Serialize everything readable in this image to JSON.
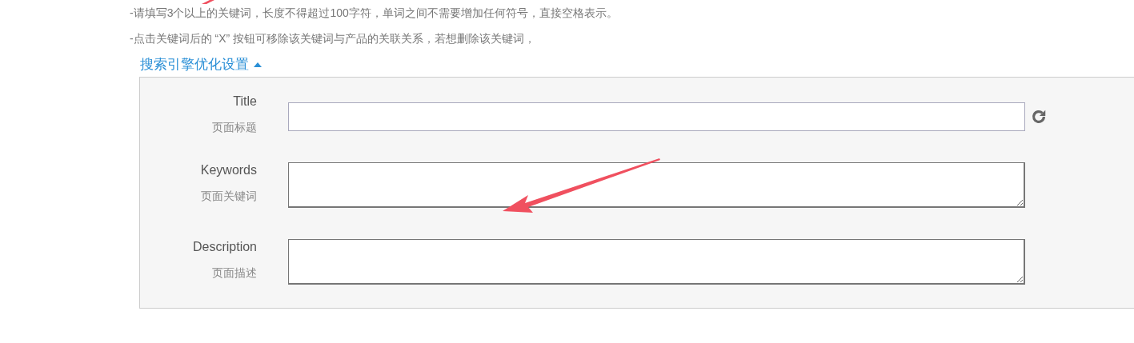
{
  "notes": [
    "-请填写3个以上的关键词，长度不得超过100字符，单词之间不需要增加任何符号，直接空格表示。",
    "-点击关键词后的 “X” 按钮可移除该关键词与产品的关联关系，若想删除该关键词，"
  ],
  "seo_section": {
    "title": "搜索引擎优化设置",
    "expanded": true,
    "fields": [
      {
        "label": "Title",
        "sublabel": "页面标题",
        "kind": "input",
        "refresh": true
      },
      {
        "label": "Keywords",
        "sublabel": "页面关键词",
        "kind": "textarea",
        "refresh": false
      },
      {
        "label": "Description",
        "sublabel": "页面描述",
        "kind": "textarea",
        "refresh": false
      }
    ]
  }
}
